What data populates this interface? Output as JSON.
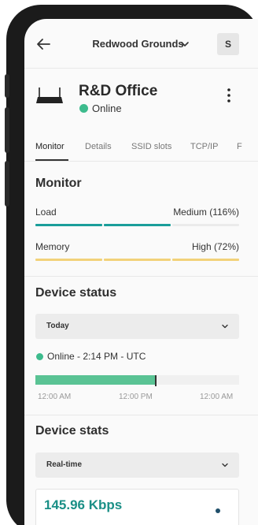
{
  "header": {
    "site_name": "Redwood Grounds",
    "avatar_initial": "S"
  },
  "device": {
    "name": "R&D Office",
    "status": "Online",
    "status_color": "#3dbb8d"
  },
  "tabs": [
    {
      "label": "Monitor",
      "active": true
    },
    {
      "label": "Details",
      "active": false
    },
    {
      "label": "SSID slots",
      "active": false
    },
    {
      "label": "TCP/IP",
      "active": false
    },
    {
      "label": "F",
      "active": false
    }
  ],
  "monitor": {
    "title": "Monitor",
    "load": {
      "label": "Load",
      "value": "Medium (116%)",
      "color": "#1a9e9a"
    },
    "memory": {
      "label": "Memory",
      "value": "High (72%)",
      "color": "#f2d27a"
    }
  },
  "device_status": {
    "title": "Device status",
    "range": "Today",
    "online_text": "Online - 2:14 PM - UTC",
    "timeline_fill_fraction": 0.59,
    "ticks": [
      "12:00 AM",
      "12:00 PM",
      "12:00 AM"
    ]
  },
  "device_stats": {
    "title": "Device stats",
    "range": "Real-time",
    "throughput": "145.96 Kbps"
  }
}
